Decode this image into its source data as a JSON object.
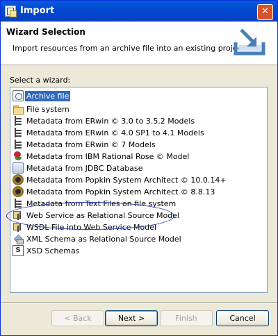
{
  "window": {
    "title": "Import",
    "close_glyph": "✕"
  },
  "header": {
    "title": "Wizard Selection",
    "description": "Import resources from an archive file into an existing project."
  },
  "wizard_list": {
    "label": "Select a wizard:",
    "items": [
      {
        "label": "Archive file",
        "icon": "archive-file-icon",
        "selected": true
      },
      {
        "label": "File system",
        "icon": "folder-icon"
      },
      {
        "label": "Metadata from ERwin © 3.0 to 3.5.2 Models",
        "icon": "metadata-icon"
      },
      {
        "label": "Metadata from ERwin © 4.0 SP1 to 4.1 Models",
        "icon": "metadata-icon"
      },
      {
        "label": "Metadata from ERwin © 7 Models",
        "icon": "metadata-icon"
      },
      {
        "label": "Metadata from IBM Rational Rose © Model",
        "icon": "rose-icon"
      },
      {
        "label": "Metadata from JDBC Database",
        "icon": "jdbc-database-icon"
      },
      {
        "label": "Metadata from Popkin System Architect © 10.0.14+",
        "icon": "popkin-icon"
      },
      {
        "label": "Metadata from Popkin System Architect © 8.8.13",
        "icon": "popkin-icon"
      },
      {
        "label": "Metadata from Text Files on file system",
        "icon": "metadata-icon"
      },
      {
        "label": "Web Service as Relational Source Model",
        "icon": "web-service-icon"
      },
      {
        "label": "WSDL File into Web Service Model",
        "icon": "web-service-icon"
      },
      {
        "label": "XML Schema as Relational Source Model",
        "icon": "xml-schema-icon"
      },
      {
        "label": "XSD Schemas",
        "icon": "xsd-icon",
        "glyph": "S"
      }
    ]
  },
  "buttons": {
    "back": "< Back",
    "next": "Next >",
    "finish": "Finish",
    "cancel": "Cancel"
  }
}
